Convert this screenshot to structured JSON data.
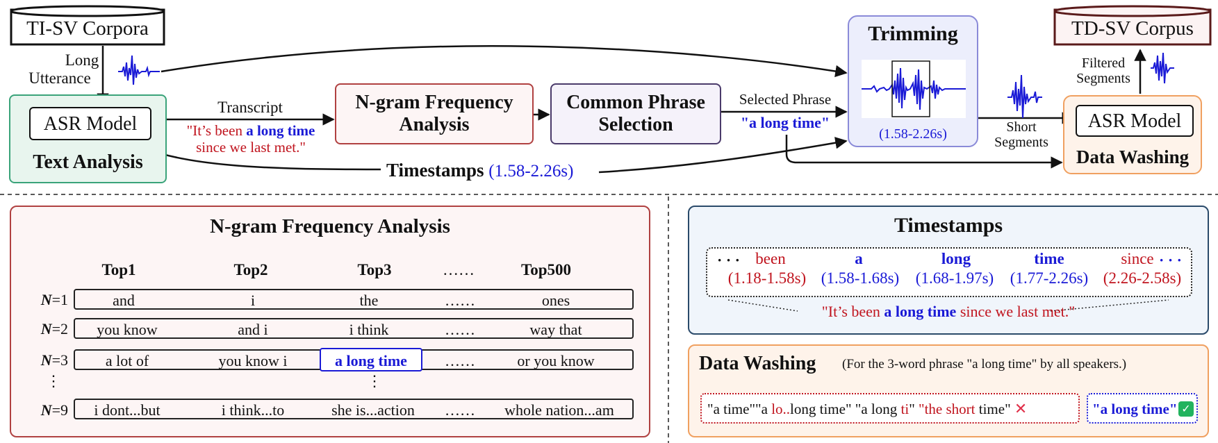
{
  "top": {
    "ti_sv_corpora": "TI-SV Corpora",
    "td_sv_corpus": "TD-SV Corpus",
    "long_utterance_1": "Long",
    "long_utterance_2": "Utterance",
    "asr_model_left": "ASR Model",
    "text_analysis": "Text Analysis",
    "transcript_label": "Transcript",
    "transcript_line1_a": "\"It’s been ",
    "transcript_line1_b": "a long time",
    "transcript_line2": "since we last met.\"",
    "ngram_box_1": "N-gram Frequency",
    "ngram_box_2": "Analysis",
    "common_phrase_1": "Common Phrase",
    "common_phrase_2": "Selection",
    "selected_phrase_label": "Selected Phrase",
    "selected_phrase_value": "\"a long time\"",
    "trimming_title": "Trimming",
    "trimming_time": "(1.58-2.26s)",
    "short_segments_1": "Short",
    "short_segments_2": "Segments",
    "asr_model_right": "ASR Model",
    "data_washing": "Data Washing",
    "filtered_segments_1": "Filtered",
    "filtered_segments_2": "Segments",
    "timestamps_label": "Timestamps",
    "timestamps_value": "(1.58-2.26s)"
  },
  "ngram_panel": {
    "title": "N-gram Frequency Analysis",
    "columns": [
      "Top1",
      "Top2",
      "Top3",
      "……",
      "Top500"
    ],
    "rows": [
      {
        "label_n": "N",
        "label_eq": "=1",
        "cells": [
          "and",
          "i",
          "the",
          "……",
          "ones"
        ]
      },
      {
        "label_n": "N",
        "label_eq": "=2",
        "cells": [
          "you know",
          "and i",
          "i think",
          "……",
          "way that"
        ]
      },
      {
        "label_n": "N",
        "label_eq": "=3",
        "cells": [
          "a lot of",
          "you know i",
          "a long time",
          "……",
          "or you know"
        ]
      },
      {
        "label_n": "N",
        "label_eq": "=9",
        "cells": [
          "i dont...but",
          "i think...to",
          "she is...action",
          "……",
          "whole nation...am"
        ]
      }
    ],
    "vdots": "⋮"
  },
  "timestamps_panel": {
    "title": "Timestamps",
    "ellipsis_left": "· · ·",
    "ellipsis_right": "· · ·",
    "words": [
      {
        "word": "been",
        "time": "(1.18-1.58s)"
      },
      {
        "word": "a",
        "time": "(1.58-1.68s)"
      },
      {
        "word": "long",
        "time": "(1.68-1.97s)"
      },
      {
        "word": "time",
        "time": "(1.77-2.26s)"
      },
      {
        "word": "since",
        "time": "(2.26-2.58s)"
      }
    ],
    "sentence_a": "\"It’s been ",
    "sentence_b": "a long time",
    "sentence_c": " since we last met.\""
  },
  "washing_panel": {
    "title": "Data Washing",
    "note": "(For the 3-word phrase \"a long time\" by all speakers.)",
    "bad_1": "\"a time\"",
    "bad_2a": "\"a ",
    "bad_2b": "lo..",
    "bad_2c": "long time\"",
    "bad_3a": "\"a long ",
    "bad_3b": "ti",
    "bad_3c": "\"",
    "bad_4a": "\"the short",
    "bad_4b": " time\"",
    "cross": "✕",
    "good": "\"a long time\"",
    "check": "✓"
  },
  "colors": {
    "red": "#c0141e",
    "blue": "#1a1ad6",
    "green_border": "#3aa37a",
    "red_border": "#b04040",
    "purple_border": "#4a3a6a",
    "blue_border": "#2a4a6a",
    "orange_border": "#f0a060"
  }
}
